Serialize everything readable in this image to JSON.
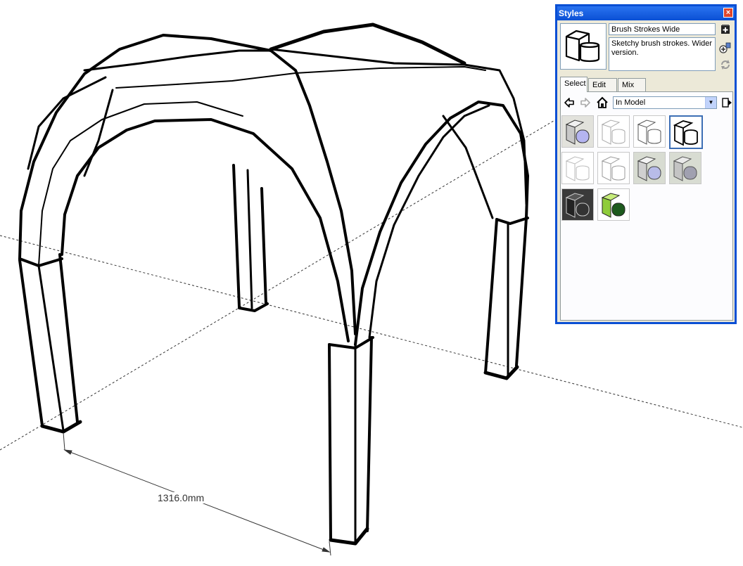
{
  "dimension": {
    "label": "1316.0mm"
  },
  "styles_panel": {
    "title": "Styles",
    "close_label": "×",
    "style_name": "Brush Strokes Wide",
    "style_description": "Sketchy brush strokes. Wider version.",
    "tabs": [
      {
        "label": "Select",
        "active": true
      },
      {
        "label": "Edit",
        "active": false
      },
      {
        "label": "Mix",
        "active": false
      }
    ],
    "collection": "In Model",
    "icons": {
      "back": "back-arrow-icon",
      "forward": "forward-arrow-icon",
      "home": "home-icon",
      "details": "details-icon",
      "new_style": "create-style-icon",
      "update_style": "update-style-icon",
      "refresh": "refresh-icon"
    },
    "thumbnails": [
      {
        "name": "default-shaded",
        "style": "shaded-blue"
      },
      {
        "name": "sketchy-1",
        "style": "sketch-light"
      },
      {
        "name": "sketchy-2",
        "style": "sketch"
      },
      {
        "name": "brush-strokes-wide",
        "style": "sketch-bold",
        "selected": true
      },
      {
        "name": "sketchy-3",
        "style": "sketch-light"
      },
      {
        "name": "sketchy-4",
        "style": "sketch-light"
      },
      {
        "name": "shaded-green-ground",
        "style": "shaded-blue-ground"
      },
      {
        "name": "shaded-gray-ground",
        "style": "shaded-gray-ground"
      },
      {
        "name": "dark-style",
        "style": "dark"
      },
      {
        "name": "green-style",
        "style": "green"
      }
    ]
  },
  "colors": {
    "window_frame": "#0a4fd4",
    "panel_bg": "#ece9d8",
    "selected_border": "#3c6eb4"
  }
}
